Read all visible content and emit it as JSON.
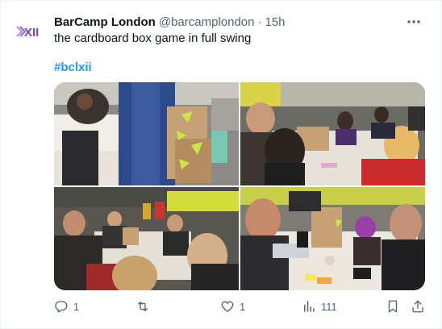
{
  "author": {
    "name": "BarCamp London",
    "handle": "@barcamplondon",
    "separator": "·",
    "time": "15h"
  },
  "tweet": {
    "text": "the cardboard box game in full swing",
    "hashtag": "#bclxii"
  },
  "media": {
    "count": 4,
    "photos": [
      {
        "position": "top-left"
      },
      {
        "position": "top-right"
      },
      {
        "position": "bottom-left"
      },
      {
        "position": "bottom-right"
      }
    ]
  },
  "actions": {
    "replies": "1",
    "retweets": "",
    "likes": "1",
    "views": "111"
  },
  "icons": {
    "avatar": "barcamp-xii-logo-icon",
    "more": "more-icon",
    "reply": "reply-icon",
    "retweet": "retweet-icon",
    "like": "like-icon",
    "views": "views-icon",
    "bookmark": "bookmark-icon",
    "share": "share-icon"
  },
  "colors": {
    "text": "#0f1419",
    "secondary": "#536471",
    "link": "#1d9bf0",
    "logo": "#7b3fe4"
  }
}
